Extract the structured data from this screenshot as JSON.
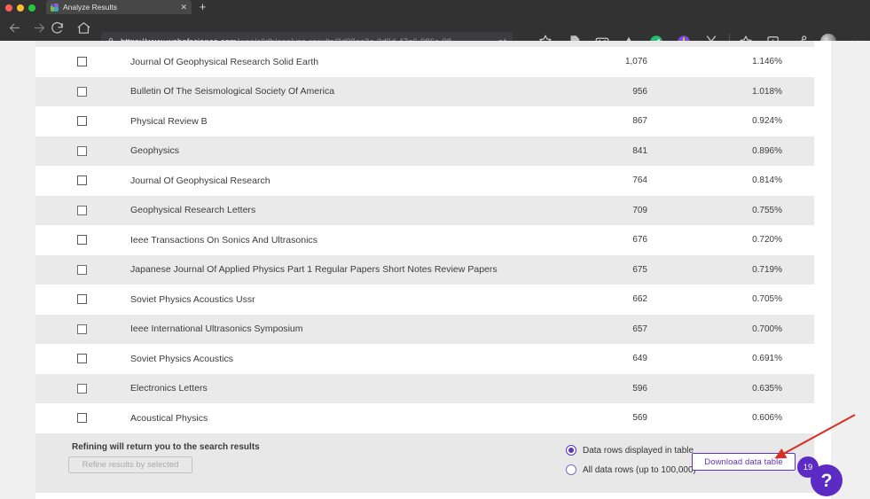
{
  "browser": {
    "tab": {
      "title": "Analyze Results",
      "close_label": "✕",
      "favicon": "webofscience-favicon"
    },
    "new_tab_label": "+",
    "address": {
      "url_secure": "https://www.webofscience.com",
      "url_path": "/wos/alldb/analyze-results/3d08ec2e-2d9d-47e6-986a-08…",
      "reader_label": "aà"
    },
    "toolbar_icons": [
      "collections-icon",
      "document-extension-icon",
      "wallet-extension-icon",
      "triangle-extension-icon",
      "check-extension-icon",
      "clock-extension-icon",
      "scissors-extension-icon",
      "favorite-icon",
      "collections-panel-icon",
      "share-icon",
      "profile-avatar",
      "more-options-icon"
    ]
  },
  "table": {
    "columns": [
      "select",
      "name",
      "records",
      "percent"
    ],
    "rows": [
      {
        "name": "Journal Of Geophysical Research Solid Earth",
        "count": "1,076",
        "percent": "1.146%"
      },
      {
        "name": "Bulletin Of The Seismological Society Of America",
        "count": "956",
        "percent": "1.018%"
      },
      {
        "name": "Physical Review B",
        "count": "867",
        "percent": "0.924%"
      },
      {
        "name": "Geophysics",
        "count": "841",
        "percent": "0.896%"
      },
      {
        "name": "Journal Of Geophysical Research",
        "count": "764",
        "percent": "0.814%"
      },
      {
        "name": "Geophysical Research Letters",
        "count": "709",
        "percent": "0.755%"
      },
      {
        "name": "Ieee Transactions On Sonics And Ultrasonics",
        "count": "676",
        "percent": "0.720%"
      },
      {
        "name": "Japanese Journal Of Applied Physics Part 1 Regular Papers Short Notes Review Papers",
        "count": "675",
        "percent": "0.719%"
      },
      {
        "name": "Soviet Physics Acoustics Ussr",
        "count": "662",
        "percent": "0.705%"
      },
      {
        "name": "Ieee International Ultrasonics Symposium",
        "count": "657",
        "percent": "0.700%"
      },
      {
        "name": "Soviet Physics Acoustics",
        "count": "649",
        "percent": "0.691%"
      },
      {
        "name": "Electronics Letters",
        "count": "596",
        "percent": "0.635%"
      },
      {
        "name": "Acoustical Physics",
        "count": "569",
        "percent": "0.606%"
      }
    ]
  },
  "footer": {
    "refine_note": "Refining will return you to the search results",
    "refine_button_label": "Refine results by selected",
    "radio_options": [
      {
        "label": "Data rows displayed in table",
        "selected": true
      },
      {
        "label": "All data rows (up to 100,000)",
        "selected": false
      }
    ],
    "download_button_label": "Download data table"
  },
  "help_widget": {
    "badge_count": "19",
    "icon_label": "?"
  },
  "colors": {
    "accent_purple": "#5e33bf",
    "help_purple": "#5b2bc4",
    "row_alt_gray": "#eaeaea",
    "footer_gray": "#e8e8e8",
    "annotation_red": "#d93025"
  }
}
